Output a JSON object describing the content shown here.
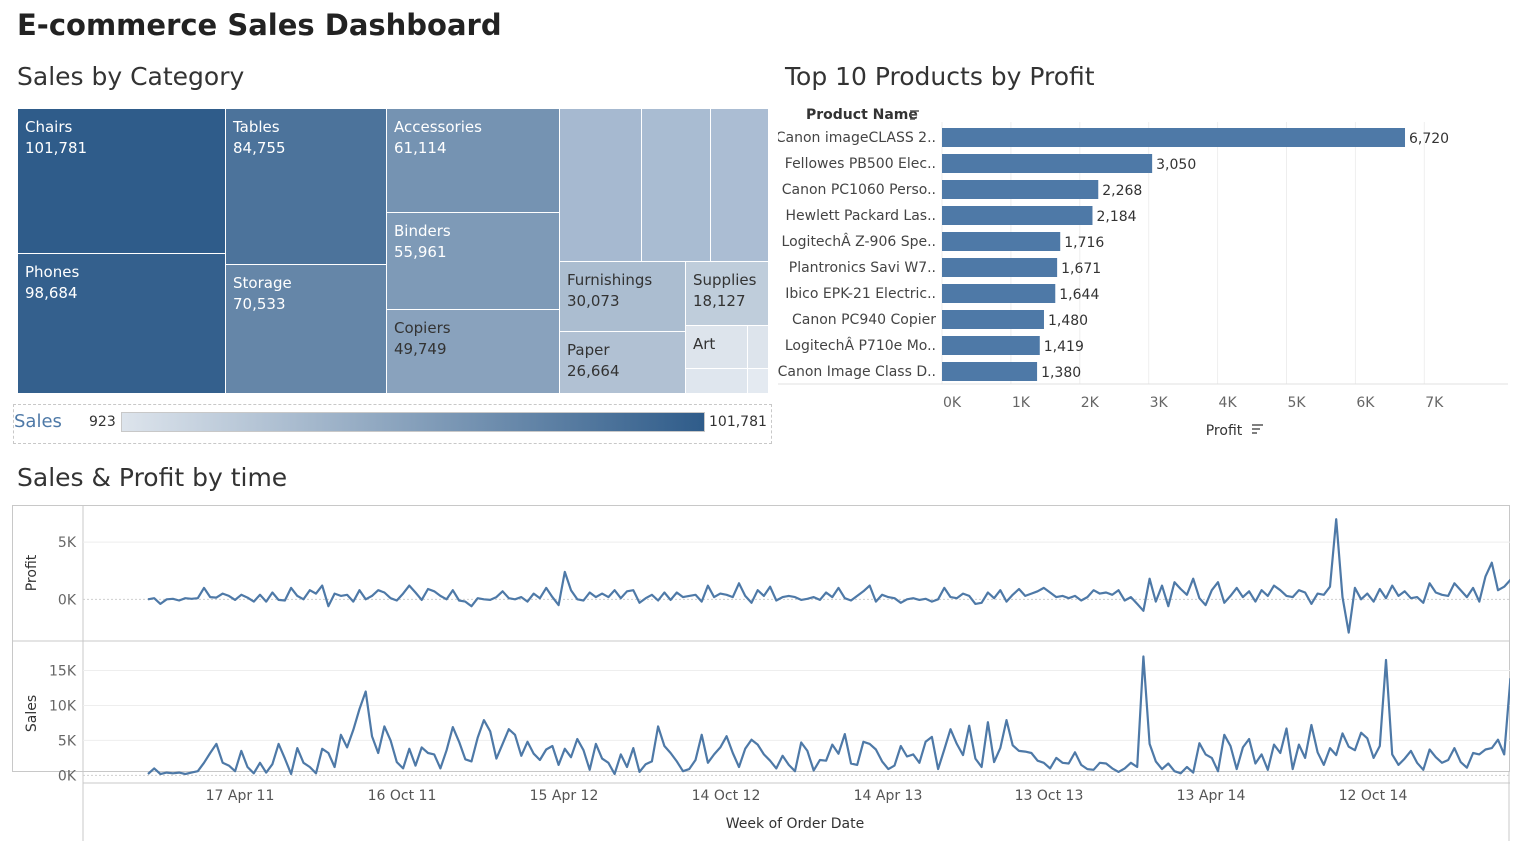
{
  "dashboard": {
    "title": "E-commerce Sales Dashboard"
  },
  "colors": {
    "accent": "#4e79a7",
    "dark": "#2f5c8a",
    "light": "#dde4ec"
  },
  "treemap": {
    "title": "Sales by Category",
    "tiles": [
      {
        "name": "Chairs",
        "value": 101781
      },
      {
        "name": "Phones",
        "value": 98684
      },
      {
        "name": "Tables",
        "value": 84755
      },
      {
        "name": "Storage",
        "value": 70533
      },
      {
        "name": "Accessories",
        "value": 61114
      },
      {
        "name": "Binders",
        "value": 55961
      },
      {
        "name": "Copiers",
        "value": 49749
      },
      {
        "name": "Furnishings",
        "value": 30073
      },
      {
        "name": "Supplies",
        "value": 18127
      },
      {
        "name": "Paper",
        "value": 26664
      },
      {
        "name": "Art",
        "value": null
      }
    ],
    "legend": {
      "label": "Sales",
      "min": "923",
      "max": "101,781"
    }
  },
  "bar_chart": {
    "title": "Top 10 Products by Profit",
    "row_header": "Product Name",
    "x_title": "Profit",
    "x_ticks": [
      "0K",
      "1K",
      "2K",
      "3K",
      "4K",
      "5K",
      "6K",
      "7K"
    ]
  },
  "line_chart": {
    "title": "Sales & Profit by time",
    "x_title": "Week of Order Date",
    "profit_axis": "Profit",
    "sales_axis": "Sales",
    "profit_ticks": [
      "5K",
      "0K"
    ],
    "sales_ticks": [
      "15K",
      "10K",
      "5K",
      "0K"
    ],
    "x_ticks": [
      "17 Apr 11",
      "16 Oct 11",
      "15 Apr 12",
      "14 Oct 12",
      "14 Apr 13",
      "13 Oct 13",
      "13 Apr 14",
      "12 Oct 14"
    ]
  },
  "chart_data": [
    {
      "type": "treemap",
      "title": "Sales by Category",
      "categories": [
        "Chairs",
        "Phones",
        "Tables",
        "Storage",
        "Accessories",
        "Binders",
        "Copiers",
        "Furnishings",
        "Supplies",
        "Paper",
        "Art"
      ],
      "values": [
        101781,
        98684,
        84755,
        70533,
        61114,
        55961,
        49749,
        30073,
        18127,
        26664,
        null
      ],
      "color_range": [
        923,
        101781
      ]
    },
    {
      "type": "bar",
      "title": "Top 10 Products by Profit",
      "orientation": "horizontal",
      "categories": [
        "Canon imageCLASS 2..",
        "Fellowes PB500 Elec..",
        "Canon PC1060 Perso..",
        "Hewlett Packard Las..",
        "LogitechÂ Z-906 Spe..",
        "Plantronics Savi W7..",
        "Ibico EPK-21 Electric..",
        "Canon PC940 Copier",
        "LogitechÂ P710e Mo..",
        "Canon Image Class D.."
      ],
      "values": [
        6720,
        3050,
        2268,
        2184,
        1716,
        1671,
        1644,
        1480,
        1419,
        1380
      ],
      "labels": [
        "6,720",
        "3,050",
        "2,268",
        "2,184",
        "1,716",
        "1,671",
        "1,644",
        "1,480",
        "1,419",
        "1,380"
      ],
      "xlabel": "Profit",
      "ylabel": "Product Name",
      "xlim": [
        0,
        7500
      ]
    },
    {
      "type": "line",
      "title": "Sales & Profit by time",
      "xlabel": "Week of Order Date",
      "x": [
        "2011-01-02",
        "2011-01-09",
        "2011-01-16",
        "2011-01-23",
        "2011-01-30",
        "2011-02-06",
        "2011-02-13",
        "2011-02-20",
        "2011-02-27",
        "2011-03-06",
        "2011-03-13",
        "2011-03-20",
        "2011-03-27",
        "2011-04-03",
        "2011-04-10",
        "2011-04-17",
        "2011-04-24",
        "2011-05-01",
        "2011-05-08",
        "2011-05-15",
        "2011-05-22",
        "2011-05-29",
        "2011-06-05",
        "2011-06-12",
        "2011-06-19",
        "2011-06-26",
        "2011-07-03",
        "2011-07-10",
        "2011-07-17",
        "2011-07-24",
        "2011-07-31",
        "2011-08-07",
        "2011-08-14",
        "2011-08-21",
        "2011-08-28",
        "2011-09-04",
        "2011-09-11",
        "2011-09-18",
        "2011-09-25",
        "2011-10-02",
        "2011-10-09",
        "2011-10-16",
        "2011-10-23",
        "2011-10-30",
        "2011-11-06",
        "2011-11-13",
        "2011-11-20",
        "2011-11-27",
        "2011-12-04",
        "2011-12-11",
        "2011-12-18",
        "2011-12-25",
        "2012-01-01",
        "2012-01-08",
        "2012-01-15",
        "2012-01-22",
        "2012-01-29",
        "2012-02-05",
        "2012-02-12",
        "2012-02-19",
        "2012-02-26",
        "2012-03-04",
        "2012-03-11",
        "2012-03-18",
        "2012-03-25",
        "2012-04-01",
        "2012-04-08",
        "2012-04-15",
        "2012-04-22",
        "2012-04-29",
        "2012-05-06",
        "2012-05-13",
        "2012-05-20",
        "2012-05-27",
        "2012-06-03",
        "2012-06-10",
        "2012-06-17",
        "2012-06-24",
        "2012-07-01",
        "2012-07-08",
        "2012-07-15",
        "2012-07-22",
        "2012-07-29",
        "2012-08-05",
        "2012-08-12",
        "2012-08-19",
        "2012-08-26",
        "2012-09-02",
        "2012-09-09",
        "2012-09-16",
        "2012-09-23",
        "2012-09-30",
        "2012-10-07",
        "2012-10-14",
        "2012-10-21",
        "2012-10-28",
        "2012-11-04",
        "2012-11-11",
        "2012-11-18",
        "2012-11-25",
        "2012-12-02",
        "2012-12-09",
        "2012-12-16",
        "2012-12-23",
        "2012-12-30",
        "2013-01-06",
        "2013-01-13",
        "2013-01-20",
        "2013-01-27",
        "2013-02-03",
        "2013-02-10",
        "2013-02-17",
        "2013-02-24",
        "2013-03-03",
        "2013-03-10",
        "2013-03-17",
        "2013-03-24",
        "2013-03-31",
        "2013-04-07",
        "2013-04-14",
        "2013-04-21",
        "2013-04-28",
        "2013-05-05",
        "2013-05-12",
        "2013-05-19",
        "2013-05-26",
        "2013-06-02",
        "2013-06-09",
        "2013-06-16",
        "2013-06-23",
        "2013-06-30",
        "2013-07-07",
        "2013-07-14",
        "2013-07-21",
        "2013-07-28",
        "2013-08-04",
        "2013-08-11",
        "2013-08-18",
        "2013-08-25",
        "2013-09-01",
        "2013-09-08",
        "2013-09-15",
        "2013-09-22",
        "2013-09-29",
        "2013-10-06",
        "2013-10-13",
        "2013-10-20",
        "2013-10-27",
        "2013-11-03",
        "2013-11-10",
        "2013-11-17",
        "2013-11-24",
        "2013-12-01",
        "2013-12-08",
        "2013-12-15",
        "2013-12-22",
        "2013-12-29",
        "2014-01-05",
        "2014-01-12",
        "2014-01-19",
        "2014-01-26",
        "2014-02-02",
        "2014-02-09",
        "2014-02-16",
        "2014-02-23",
        "2014-03-02",
        "2014-03-09",
        "2014-03-16",
        "2014-03-23",
        "2014-03-30",
        "2014-04-06",
        "2014-04-13",
        "2014-04-20",
        "2014-04-27",
        "2014-05-04",
        "2014-05-11",
        "2014-05-18",
        "2014-05-25",
        "2014-06-01",
        "2014-06-08",
        "2014-06-15",
        "2014-06-22",
        "2014-06-29",
        "2014-07-06",
        "2014-07-13",
        "2014-07-20",
        "2014-07-27",
        "2014-08-03",
        "2014-08-10",
        "2014-08-17",
        "2014-08-24",
        "2014-08-31",
        "2014-09-07",
        "2014-09-14",
        "2014-09-21",
        "2014-09-28",
        "2014-10-05",
        "2014-10-12",
        "2014-10-19",
        "2014-10-26",
        "2014-11-02",
        "2014-11-09",
        "2014-11-16",
        "2014-11-23",
        "2014-11-30",
        "2014-12-07",
        "2014-12-14",
        "2014-12-21",
        "2014-12-28"
      ],
      "series": [
        {
          "name": "Profit",
          "ylim": [
            -3200,
            7800
          ],
          "values": [
            0,
            100,
            -400,
            0,
            50,
            -100,
            100,
            50,
            100,
            1000,
            200,
            150,
            500,
            300,
            -50,
            400,
            150,
            -200,
            400,
            -200,
            600,
            -50,
            -100,
            1000,
            300,
            0,
            800,
            500,
            1200,
            -600,
            500,
            300,
            400,
            -200,
            800,
            0,
            300,
            800,
            600,
            100,
            -100,
            500,
            1200,
            600,
            -50,
            900,
            700,
            300,
            0,
            800,
            -100,
            -200,
            -600,
            100,
            0,
            -50,
            200,
            700,
            100,
            0,
            200,
            -200,
            500,
            100,
            1000,
            200,
            -500,
            2400,
            800,
            0,
            -100,
            600,
            200,
            500,
            200,
            800,
            100,
            700,
            800,
            -300,
            100,
            400,
            -100,
            600,
            -50,
            600,
            200,
            300,
            400,
            -200,
            1200,
            200,
            500,
            400,
            200,
            1400,
            300,
            -300,
            800,
            300,
            1100,
            -100,
            200,
            300,
            200,
            -50,
            50,
            200,
            -50,
            600,
            200,
            1000,
            100,
            -100,
            300,
            700,
            1200,
            -200,
            400,
            200,
            100,
            -300,
            0,
            100,
            -50,
            50,
            -200,
            0,
            1000,
            200,
            100,
            500,
            300,
            -400,
            -300,
            600,
            100,
            800,
            -200,
            400,
            900,
            300,
            500,
            700,
            1000,
            600,
            200,
            300,
            100,
            300,
            -100,
            200,
            800,
            500,
            600,
            400,
            800,
            -100,
            200,
            -400,
            -1000,
            1800,
            -200,
            1200,
            -600,
            1500,
            900,
            400,
            1800,
            100,
            -500,
            800,
            1500,
            -300,
            300,
            1000,
            200,
            700,
            -200,
            800,
            300,
            1200,
            800,
            300,
            200,
            800,
            600,
            -400,
            500,
            400,
            1100,
            7000,
            200,
            -2900,
            1000,
            0,
            500,
            -200,
            900,
            100,
            1200,
            300,
            700,
            100,
            200,
            -300,
            1400,
            600,
            400,
            300,
            1400,
            800,
            200,
            1000,
            -200,
            2000,
            3200,
            800,
            1100,
            1700,
            1000,
            200,
            900,
            1700,
            500,
            -100,
            900,
            300,
            1200,
            -300,
            700,
            1100,
            1400,
            600,
            1100,
            100,
            1500,
            300
          ]
        },
        {
          "name": "Sales",
          "ylim": [
            -800,
            18500
          ],
          "values": [
            200,
            1000,
            200,
            400,
            300,
            400,
            200,
            400,
            600,
            1800,
            3200,
            4500,
            1800,
            1400,
            600,
            3500,
            1200,
            300,
            1800,
            400,
            1600,
            4500,
            2400,
            200,
            3900,
            1800,
            1200,
            300,
            3800,
            3200,
            1200,
            5800,
            4000,
            6500,
            9500,
            12000,
            5600,
            3200,
            7000,
            5000,
            1900,
            1000,
            3800,
            1400,
            4000,
            3200,
            3000,
            1000,
            3600,
            6900,
            4800,
            2300,
            2000,
            5400,
            7900,
            6300,
            2400,
            4500,
            6600,
            5800,
            2800,
            4800,
            3100,
            2200,
            3700,
            4200,
            1500,
            3800,
            2600,
            5200,
            3600,
            800,
            4500,
            2400,
            1800,
            200,
            3000,
            1200,
            3900,
            500,
            1600,
            2000,
            7000,
            4200,
            3200,
            2000,
            600,
            900,
            2200,
            5800,
            1800,
            3000,
            4000,
            5600,
            3200,
            1200,
            3800,
            5100,
            4400,
            3000,
            2100,
            1000,
            2800,
            1500,
            600,
            4700,
            3500,
            700,
            2200,
            2100,
            4400,
            3100,
            5900,
            1700,
            1500,
            4800,
            4500,
            3700,
            2000,
            900,
            1400,
            4200,
            2700,
            3000,
            1800,
            4800,
            5500,
            900,
            3700,
            6600,
            4500,
            2900,
            7100,
            2400,
            1200,
            7600,
            1900,
            3900,
            7900,
            4300,
            3500,
            3400,
            3200,
            2100,
            1800,
            1000,
            2500,
            1800,
            1700,
            3300,
            1500,
            900,
            800,
            1800,
            1700,
            1000,
            500,
            1000,
            1800,
            1200,
            17000,
            4500,
            2000,
            900,
            1700,
            600,
            300,
            1200,
            400,
            4600,
            3000,
            2500,
            600,
            5800,
            4200,
            900,
            4000,
            5200,
            1700,
            3000,
            800,
            4400,
            3200,
            6700,
            900,
            4400,
            2500,
            7200,
            3300,
            1500,
            3900,
            2900,
            6000,
            4100,
            3600,
            6100,
            5300,
            2500,
            4200,
            16500,
            3000,
            1500,
            2400,
            3500,
            1800,
            800,
            3700,
            2600,
            1800,
            2200,
            3900,
            1900,
            1100,
            3200,
            3000,
            3700,
            3900,
            5100,
            3000,
            13800,
            6900,
            8200,
            4900,
            7600,
            5500,
            4300,
            5200,
            2800,
            6900,
            3300,
            2600,
            4400,
            4300,
            1100,
            5400,
            11200,
            8700,
            5700,
            3400,
            7900,
            9600,
            2500,
            7800,
            2200
          ]
        }
      ]
    }
  ]
}
